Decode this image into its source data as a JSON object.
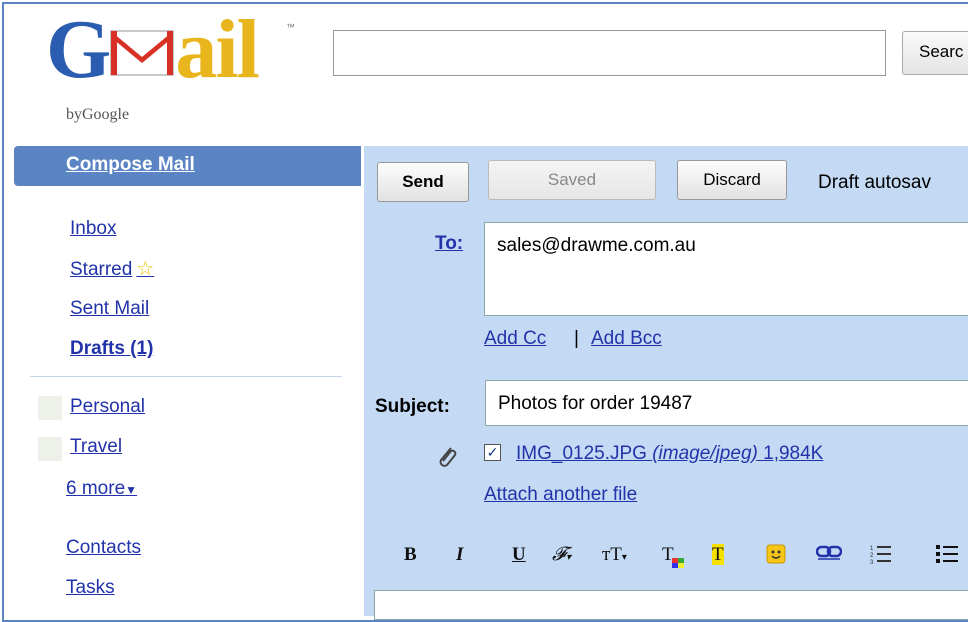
{
  "brand": {
    "part1": "G",
    "part2": "ail",
    "tm": "™",
    "by": "byGoogle"
  },
  "search": {
    "button_label": "Searc",
    "value": ""
  },
  "sidebar": {
    "compose": "Compose Mail",
    "items": [
      {
        "label": "Inbox"
      },
      {
        "label": "Starred"
      },
      {
        "label": "Sent Mail"
      },
      {
        "label": "Drafts (1)"
      }
    ],
    "labels": [
      {
        "label": "Personal"
      },
      {
        "label": "Travel"
      }
    ],
    "more": "6 more",
    "contacts": "Contacts",
    "tasks": "Tasks"
  },
  "compose": {
    "send": "Send",
    "saved": "Saved",
    "discard": "Discard",
    "autosave": "Draft autosav",
    "to_label": "To:",
    "to_value": "sales@drawme.com.au",
    "add_cc": "Add Cc",
    "separator": "|",
    "add_bcc": "Add Bcc",
    "subject_label": "Subject:",
    "subject_value": "Photos for order 19487",
    "attachment": {
      "name": "IMG_0125.JPG",
      "type": "(image/jpeg)",
      "size": "1,984K",
      "checked": true
    },
    "attach_another": "Attach another file"
  },
  "toolbar": {
    "bold": "B",
    "italic": "I",
    "underline": "U",
    "font": "𝓕",
    "size": "тT",
    "text_color": "T",
    "highlight": "T"
  }
}
